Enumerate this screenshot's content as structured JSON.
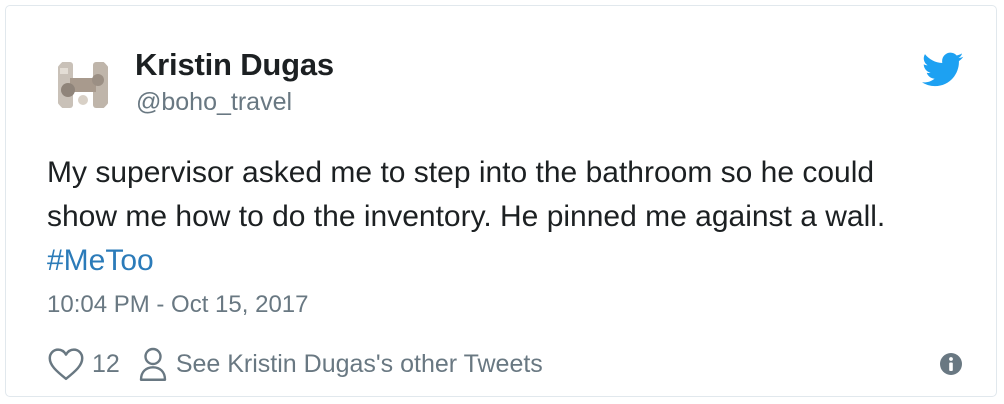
{
  "author": {
    "name": "Kristin Dugas",
    "handle": "@boho_travel"
  },
  "tweet": {
    "line1": "My supervisor asked me to step into the bathroom so he could",
    "line2": "show me how to do the inventory. He pinned me against a wall.",
    "hashtag": "#MeToo",
    "timestamp": "10:04 PM - Oct 15, 2017"
  },
  "actions": {
    "like_count": "12",
    "other_tweets_label": "See Kristin Dugas's other Tweets"
  },
  "icons": {
    "brand": "twitter-bird-icon",
    "like": "heart-icon",
    "profile": "person-icon",
    "info": "info-icon"
  },
  "colors": {
    "text": "#1c2022",
    "secondary": "#697882",
    "link": "#2b7bb9",
    "twitter_blue": "#1da1f2",
    "border": "#e1e8ed"
  }
}
